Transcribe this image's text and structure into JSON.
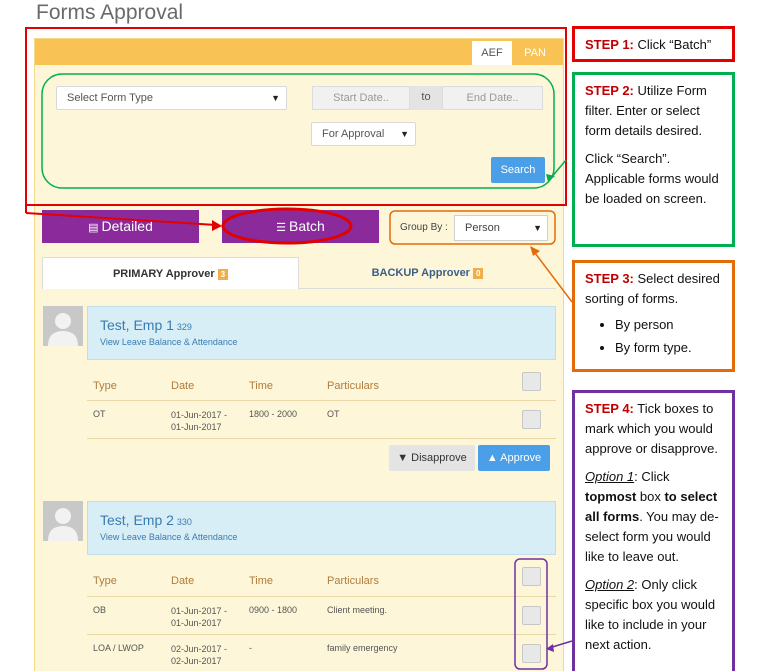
{
  "page_title": "Forms Approval",
  "tabs": {
    "aef": "AEF",
    "pan": "PAN"
  },
  "filter": {
    "form_type_placeholder": "Select Form Type",
    "start_date_placeholder": "Start Date..",
    "to_label": "to",
    "end_date_placeholder": "End Date..",
    "status_value": "For Approval",
    "search_label": "Search"
  },
  "view_buttons": {
    "detailed": "Detailed",
    "batch": "Batch"
  },
  "group_by": {
    "label": "Group By :",
    "value": "Person"
  },
  "approver_tabs": {
    "primary": {
      "label": "PRIMARY Approver",
      "count": "3"
    },
    "backup": {
      "label": "BACKUP Approver",
      "count": "0"
    }
  },
  "columns": [
    "Type",
    "Date",
    "Time",
    "Particulars"
  ],
  "employees": [
    {
      "name": "Test, Emp 1",
      "id": "329",
      "link": "View Leave Balance & Attendance",
      "rows": [
        {
          "type": "OT",
          "date": "01-Jun-2017 - 01-Jun-2017",
          "time": "1800 - 2000",
          "particulars": "OT"
        }
      ]
    },
    {
      "name": "Test, Emp 2",
      "id": "330",
      "link": "View Leave Balance & Attendance",
      "rows": [
        {
          "type": "OB",
          "date": "01-Jun-2017 - 01-Jun-2017",
          "time": "0900 - 1800",
          "particulars": "Client meeting."
        },
        {
          "type": "LOA / LWOP",
          "date": "02-Jun-2017 - 02-Jun-2017",
          "time": "-",
          "particulars": "family emergency"
        }
      ]
    }
  ],
  "actions": {
    "disapprove": "Disapprove",
    "approve": "Approve"
  },
  "annotations": {
    "step1": {
      "step": "STEP 1:",
      "text": "Click “Batch”"
    },
    "step2": {
      "step": "STEP 2:",
      "text": "Utilize Form filter. Enter or select form details desired.",
      "text2": "Click “Search”. Applicable forms would be loaded on screen."
    },
    "step3": {
      "step": "STEP 3:",
      "text": "Select desired sorting of forms.",
      "bullets": [
        "By person",
        "By form type."
      ]
    },
    "step4": {
      "step": "STEP 4:",
      "text": "Tick boxes to mark which you would approve or disapprove.",
      "option1_label": "Option 1",
      "option1_a": ": Click ",
      "option1_b": "topmost",
      "option1_c": " box ",
      "option1_d": "to select all forms",
      "option1_e": ". You may de-select form you would like to leave out.",
      "option2_label": "Option 2",
      "option2_text": ": Only click specific box you would like to include in your next action."
    }
  },
  "colors": {
    "red": "#e30000",
    "green": "#00b050",
    "orange": "#e36c09",
    "purple": "#7030a0",
    "panel_header": "#f8c354",
    "batch_purple": "#8b2b9b"
  }
}
